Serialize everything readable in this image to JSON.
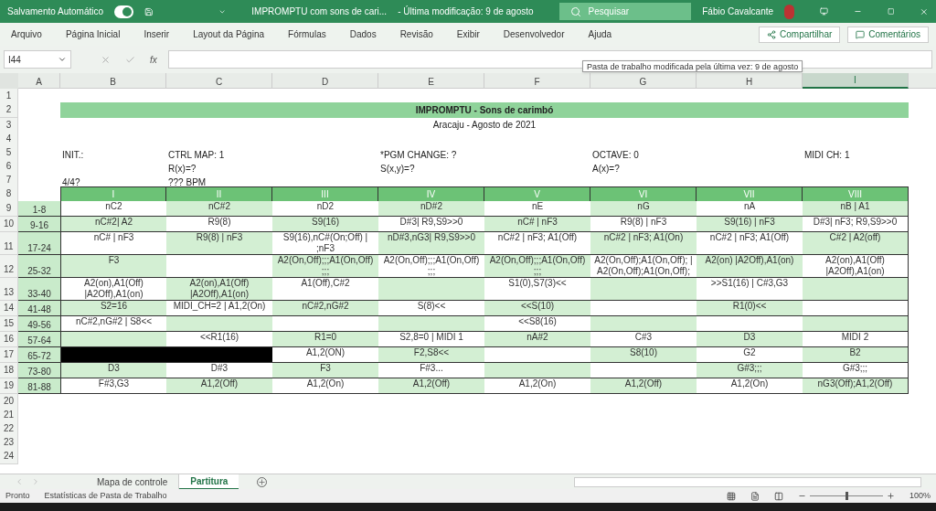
{
  "title_bar": {
    "autosave_label": "Salvamento Automático",
    "autosave_on": true,
    "document_title": "IMPROMPTU com sons de cari...",
    "modified": "-  Última modificação: 9 de agosto",
    "search_placeholder": "Pesquisar",
    "user": "Fábio Cavalcante"
  },
  "ribbon_tabs": [
    "Arquivo",
    "Página Inicial",
    "Inserir",
    "Layout da Página",
    "Fórmulas",
    "Dados",
    "Revisão",
    "Exibir",
    "Desenvolvedor",
    "Ajuda"
  ],
  "ribbon_buttons": [
    {
      "kind": "share",
      "label": "Compartilhar"
    },
    {
      "kind": "comments",
      "label": "Comentários"
    }
  ],
  "formula_bar": {
    "name_box": "I44",
    "function_label": "fx"
  },
  "tooltip": "Pasta de trabalho modificada pela última vez: 9 de agosto",
  "columns": [
    {
      "label": "A",
      "selected": false
    },
    {
      "label": "B",
      "selected": false
    },
    {
      "label": "C",
      "selected": false
    },
    {
      "label": "D",
      "selected": false
    },
    {
      "label": "E",
      "selected": false
    },
    {
      "label": "F",
      "selected": false
    },
    {
      "label": "G",
      "selected": false
    },
    {
      "label": "H",
      "selected": false
    },
    {
      "label": "I",
      "selected": true
    }
  ],
  "rows": [
    {
      "number": "1",
      "kind": "blank"
    },
    {
      "number": "2",
      "kind": "title",
      "text": "IMPROMPTU - Sons de carimbó"
    },
    {
      "number": "3",
      "kind": "subtitle",
      "text": "Aracaju - Agosto de 2021"
    },
    {
      "number": "4",
      "kind": "blank"
    },
    {
      "number": "5",
      "kind": "info",
      "cells": {
        "B": "INIT.:",
        "C": "CTRL MAP: 1",
        "E": "*PGM CHANGE: ?",
        "G": "OCTAVE: 0",
        "I": "MIDI CH: 1"
      }
    },
    {
      "number": "6",
      "kind": "info",
      "cells": {
        "C": "R(x)=?",
        "E": "S(x,y)=?",
        "G": "A(x)=?"
      }
    },
    {
      "number": "7",
      "kind": "info",
      "cells": {
        "B": "4/4?",
        "C": "??? BPM"
      }
    },
    {
      "number": "8",
      "kind": "header",
      "cells": {
        "B": "I",
        "C": "II",
        "D": "III",
        "E": "IV",
        "F": "V",
        "G": "VI",
        "H": "VII",
        "I": "VIII"
      }
    },
    {
      "number": "9",
      "kind": "table",
      "cells": {
        "A": "1-8",
        "B": "nC2",
        "C": "nC#2",
        "D": "nD2",
        "E": "nD#2",
        "F": "nE",
        "G": "nG",
        "H": "nA",
        "I": "nB | A1"
      }
    },
    {
      "number": "10",
      "kind": "table",
      "cells": {
        "A": "9-16",
        "B": "nC#2| A2",
        "C": "R9(8)",
        "D": "S9(16)",
        "E": "D#3| R9,S9>>0",
        "F": "nC# | nF3",
        "G": "R9(8) | nF3",
        "H": "S9(16) | nF3",
        "I": "D#3| nF3; R9,S9>>0"
      }
    },
    {
      "number": "11",
      "kind": "table",
      "cells": {
        "A": "17-24",
        "B": "nC# | nF3",
        "C": "R9(8) | nF3",
        "D": "S9(16),nC#(On;Off) | ;nF3",
        "E": "nD#3,nG3| R9,S9>>0",
        "F": "nC#2 | nF3; A1(Off)",
        "G": "nC#2 | nF3; A1(On)",
        "H": "nC#2 | nF3; A1(Off)",
        "I": "C#2 | A2(off)"
      }
    },
    {
      "number": "12",
      "kind": "table",
      "cells": {
        "A": "25-32",
        "B": "F3",
        "D": "A2(On,Off);;;A1(On,Off) ;;;",
        "E": "A2(On,Off);;;A1(On,Off) ;;;",
        "F": "A2(On,Off);;;A1(On,Off) ;;;",
        "G": "A2(On,Off);A1(On,Off); | A2(On,Off);A1(On,Off);",
        "H": "A2(on) |A2Off),A1(on)",
        "I": "A2(on),A1(Off) |A2Off),A1(on)"
      }
    },
    {
      "number": "13",
      "kind": "table",
      "cells": {
        "A": "33-40",
        "B": "A2(on),A1(Off) |A2Off),A1(on)",
        "C": "A2(on),A1(Off) |A2Off),A1(on)",
        "D": "A1(Off),C#2",
        "F": "S1(0),S7(3)<<",
        "H": ">>S1(16) | C#3,G3"
      }
    },
    {
      "number": "14",
      "kind": "table",
      "cells": {
        "A": "41-48",
        "B": "S2=16",
        "C": "MIDI_CH=2 | A1,2(On)",
        "D": "nC#2,nG#2",
        "E": "S(8)<<",
        "F": "<<S(10)",
        "H": "R1(0)<<"
      }
    },
    {
      "number": "15",
      "kind": "table",
      "cells": {
        "A": "49-56",
        "B": "nC#2,nG#2 | S8<<",
        "F": "<<S8(16)"
      }
    },
    {
      "number": "16",
      "kind": "table",
      "cells": {
        "A": "57-64",
        "C": "<<R1(16)",
        "D": "R1=0",
        "E": "S2,8=0 | MIDI 1",
        "F": "nA#2",
        "G": "C#3",
        "H": "D3",
        "I": "MIDI 2"
      }
    },
    {
      "number": "17",
      "kind": "table",
      "cells": {
        "A": "65-72",
        "B": {
          "kind": "filled"
        },
        "C": {
          "kind": "filled"
        },
        "D": "A1,2(ON)",
        "E": "F2,S8<<",
        "G": "S8(10)",
        "H": "G2",
        "I": "B2"
      }
    },
    {
      "number": "18",
      "kind": "table",
      "cells": {
        "A": "73-80",
        "B": "D3",
        "C": "D#3",
        "D": "F3",
        "E": "F#3...",
        "H": "G#3;;;",
        "I": "G#3;;;"
      }
    },
    {
      "number": "19",
      "kind": "table",
      "cells": {
        "A": "81-88",
        "B": "F#3,G3",
        "C": "A1,2(Off)",
        "D": "A1,2(On)",
        "E": "A1,2(Off)",
        "F": "A1,2(On)",
        "G": "A1,2(Off)",
        "H": "A1,2(On)",
        "I": "nG3(Off);A1,2(Off)"
      }
    },
    {
      "number": "20",
      "kind": "blank"
    },
    {
      "number": "21",
      "kind": "blank"
    },
    {
      "number": "22",
      "kind": "blank"
    },
    {
      "number": "23",
      "kind": "blank"
    },
    {
      "number": "24",
      "kind": "blank"
    }
  ],
  "sheet_tabs": [
    {
      "label": "Mapa de controle",
      "selected": false
    },
    {
      "label": "Partitura",
      "selected": true
    }
  ],
  "status_bar": {
    "status": "Pronto",
    "stats": "Estatísticas de Pasta de Trabalho",
    "zoom": {
      "label": "100%",
      "level": 0.5
    }
  }
}
